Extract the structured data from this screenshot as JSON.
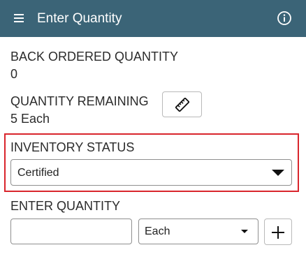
{
  "header": {
    "title": "Enter Quantity",
    "background_color": "#3b6477",
    "menu_icon": "hamburger-menu-icon",
    "info_icon": "info-circle-icon"
  },
  "fields": {
    "back_ordered": {
      "label": "BACK ORDERED QUANTITY",
      "value": "0"
    },
    "remaining": {
      "label": "QUANTITY REMAINING",
      "value": "5 Each",
      "action_icon": "ruler-measure-icon"
    },
    "inventory_status": {
      "label": "INVENTORY STATUS",
      "selected": "Certified",
      "highlight_color": "#d9252c"
    },
    "enter_quantity": {
      "label": "ENTER QUANTITY",
      "value": "",
      "unit_selected": "Each",
      "add_icon": "plus-icon"
    }
  }
}
